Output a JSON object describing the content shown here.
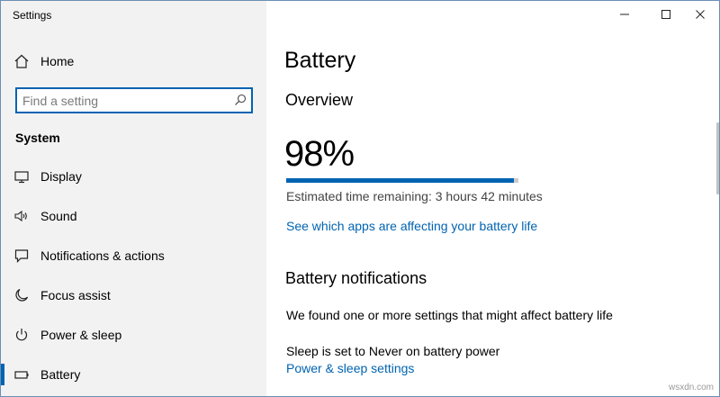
{
  "window": {
    "title": "Settings"
  },
  "sidebar": {
    "home_label": "Home",
    "search_placeholder": "Find a setting",
    "section_header": "System",
    "items": [
      {
        "label": "Display",
        "icon": "display-icon"
      },
      {
        "label": "Sound",
        "icon": "speaker-icon"
      },
      {
        "label": "Notifications & actions",
        "icon": "notification-icon"
      },
      {
        "label": "Focus assist",
        "icon": "moon-icon"
      },
      {
        "label": "Power & sleep",
        "icon": "power-icon"
      },
      {
        "label": "Battery",
        "icon": "battery-icon",
        "selected": true
      }
    ]
  },
  "main": {
    "title": "Battery",
    "overview_heading": "Overview",
    "battery_percent_text": "98%",
    "battery_level_percent": 98,
    "estimated_time": "Estimated time remaining: 3 hours 42 minutes",
    "apps_link": "See which apps are affecting your battery life",
    "notifications_heading": "Battery notifications",
    "notice_text": "We found one or more settings that might affect battery life",
    "sleep_text": "Sleep is set to Never on battery power",
    "power_sleep_link": "Power & sleep settings"
  },
  "watermark": "wsxdn.com",
  "colors": {
    "accent": "#0063b1",
    "sidebar_bg": "#f2f2f2",
    "bar_track": "#cccccc"
  }
}
